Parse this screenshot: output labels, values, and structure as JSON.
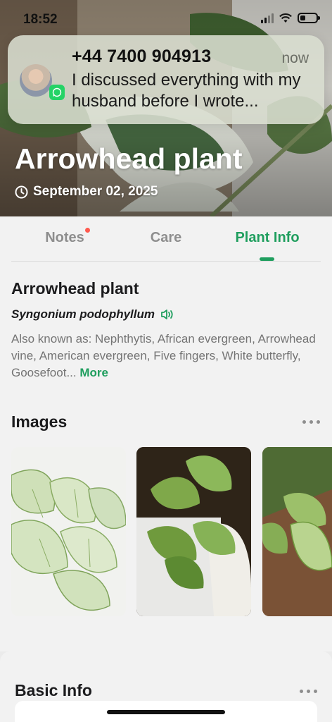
{
  "status_bar": {
    "time": "18:52"
  },
  "notification": {
    "sender": "+44 7400 904913",
    "time": "now",
    "message": "I discussed everything with my husband before I wrote...",
    "app_icon": "whatsapp-icon"
  },
  "hero": {
    "title": "Arrowhead plant",
    "date": "September 02, 2025"
  },
  "tabs": [
    {
      "label": "Notes",
      "has_dot": true
    },
    {
      "label": "Care"
    },
    {
      "label": "Plant Info",
      "active": true
    }
  ],
  "plant": {
    "common_name": "Arrowhead plant",
    "scientific_name": "Syngonium podophyllum",
    "aka": "Also known as: Nephthytis, African evergreen, Arrowhead vine, American evergreen, Five fingers, White butterfly, Goosefoot...",
    "more_label": "More"
  },
  "images_section": {
    "title": "Images"
  },
  "basic_info": {
    "title": "Basic Info"
  },
  "colors": {
    "accent": "#1f9e5e",
    "dot": "#ff5a4e"
  }
}
